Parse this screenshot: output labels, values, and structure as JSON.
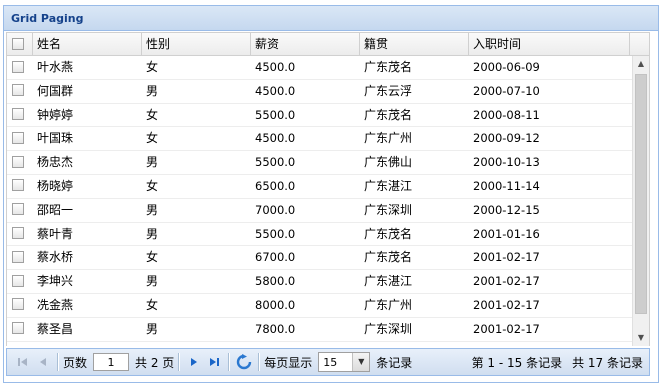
{
  "panel": {
    "title": "Grid Paging"
  },
  "columns": [
    "姓名",
    "性别",
    "薪资",
    "籍贯",
    "入职时间"
  ],
  "rows": [
    [
      "叶水燕",
      "女",
      "4500.0",
      "广东茂名",
      "2000-06-09"
    ],
    [
      "何国群",
      "男",
      "4500.0",
      "广东云浮",
      "2000-07-10"
    ],
    [
      "钟婷婷",
      "女",
      "5500.0",
      "广东茂名",
      "2000-08-11"
    ],
    [
      "叶国珠",
      "女",
      "4500.0",
      "广东广州",
      "2000-09-12"
    ],
    [
      "杨忠杰",
      "男",
      "5500.0",
      "广东佛山",
      "2000-10-13"
    ],
    [
      "杨晓婷",
      "女",
      "6500.0",
      "广东湛江",
      "2000-11-14"
    ],
    [
      "邵昭一",
      "男",
      "7000.0",
      "广东深圳",
      "2000-12-15"
    ],
    [
      "蔡叶青",
      "男",
      "5500.0",
      "广东茂名",
      "2001-01-16"
    ],
    [
      "蔡水桥",
      "女",
      "6700.0",
      "广东茂名",
      "2001-02-17"
    ],
    [
      "李坤兴",
      "男",
      "5800.0",
      "广东湛江",
      "2001-02-17"
    ],
    [
      "冼金燕",
      "女",
      "8000.0",
      "广东广州",
      "2001-02-17"
    ],
    [
      "蔡圣昌",
      "男",
      "7800.0",
      "广东深圳",
      "2001-02-17"
    ]
  ],
  "pager": {
    "page_label": "页数",
    "page_value": "1",
    "total_pages": "共 2 页",
    "per_page_label": "每页显示",
    "page_size": "15",
    "records_label": "条记录",
    "range_info": "第 1 - 15 条记录",
    "total_info": "共 17 条记录"
  },
  "icons": {
    "first": "first-page-icon",
    "prev": "prev-page-icon",
    "next": "next-page-icon",
    "last": "last-page-icon",
    "refresh": "refresh-icon"
  }
}
